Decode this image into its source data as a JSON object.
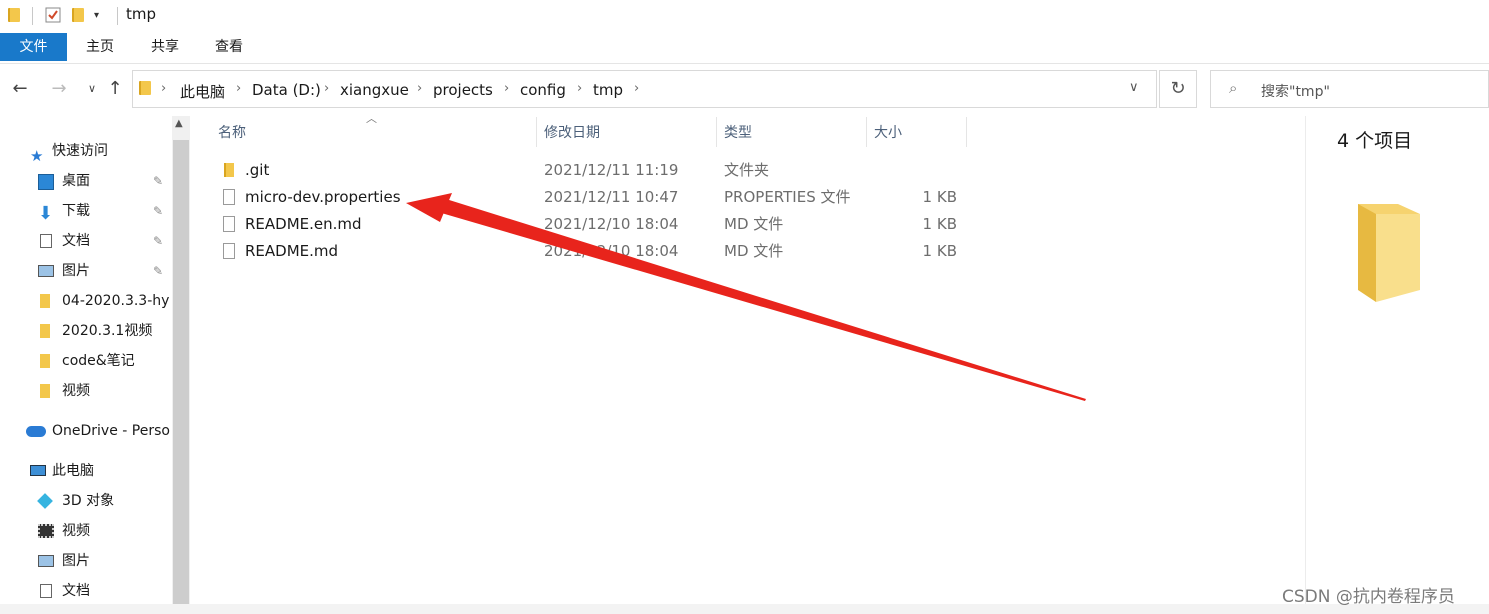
{
  "window": {
    "title": "tmp"
  },
  "ribbon": {
    "tabs": [
      "文件",
      "主页",
      "共享",
      "查看"
    ]
  },
  "address": {
    "crumbs": [
      "此电脑",
      "Data (D:)",
      "xiangxue",
      "projects",
      "config",
      "tmp"
    ],
    "search_placeholder": "搜索\"tmp\""
  },
  "nav": {
    "items": [
      {
        "label": "快速访问",
        "icon": "star-icon"
      },
      {
        "label": "桌面",
        "icon": "desktop-icon",
        "pinned": true
      },
      {
        "label": "下载",
        "icon": "download-icon",
        "pinned": true
      },
      {
        "label": "文档",
        "icon": "document-icon",
        "pinned": true
      },
      {
        "label": "图片",
        "icon": "picture-icon",
        "pinned": true
      },
      {
        "label": "04-2020.3.3-hy",
        "icon": "folder-icon"
      },
      {
        "label": "2020.3.1视频",
        "icon": "folder-icon"
      },
      {
        "label": "code&笔记",
        "icon": "folder-icon"
      },
      {
        "label": "视频",
        "icon": "folder-icon"
      },
      {
        "label": "OneDrive - Perso",
        "icon": "cloud-icon"
      },
      {
        "label": "此电脑",
        "icon": "computer-icon"
      },
      {
        "label": "3D 对象",
        "icon": "cube-icon"
      },
      {
        "label": "视频",
        "icon": "video-icon"
      },
      {
        "label": "图片",
        "icon": "picture-icon"
      },
      {
        "label": "文档",
        "icon": "document-icon"
      }
    ]
  },
  "columns": {
    "name": "名称",
    "date": "修改日期",
    "type": "类型",
    "size": "大小"
  },
  "files": [
    {
      "name": ".git",
      "date": "2021/12/11 11:19",
      "type": "文件夹",
      "size": "",
      "icon": "folder-icon"
    },
    {
      "name": "micro-dev.properties",
      "date": "2021/12/11 10:47",
      "type": "PROPERTIES 文件",
      "size": "1 KB",
      "icon": "file-icon"
    },
    {
      "name": "README.en.md",
      "date": "2021/12/10 18:04",
      "type": "MD 文件",
      "size": "1 KB",
      "icon": "file-icon"
    },
    {
      "name": "README.md",
      "date": "2021/12/10 18:04",
      "type": "MD 文件",
      "size": "1 KB",
      "icon": "file-icon"
    }
  ],
  "details": {
    "count": "4 个项目"
  },
  "watermark": "CSDN @抗内卷程序员",
  "colors": {
    "accent": "#1979ca",
    "arrow": "#e8241c",
    "folder": "#f3c74b"
  }
}
